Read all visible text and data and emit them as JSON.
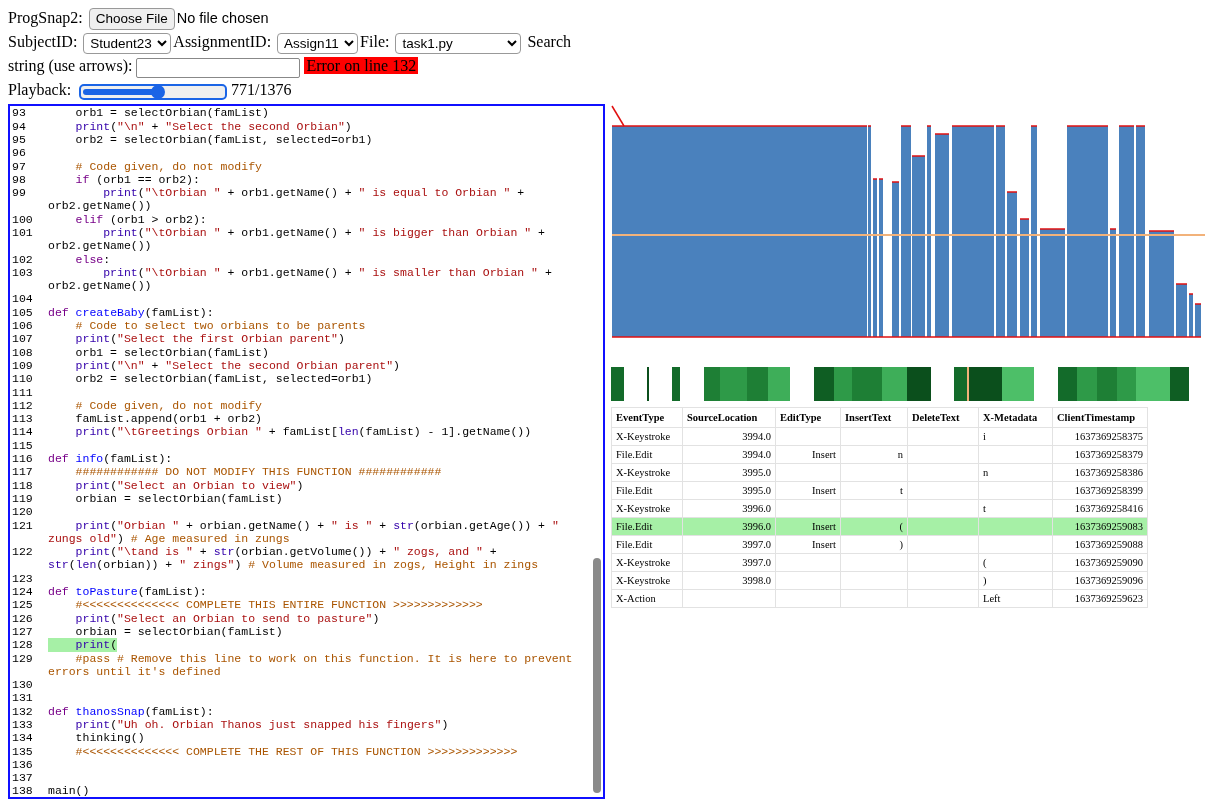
{
  "header": {
    "file_label": "ProgSnap2:",
    "file_button": "Choose File",
    "file_status": "No file chosen",
    "subject_label": "SubjectID:",
    "subject": "Student23",
    "assignment_label": "AssignmentID:",
    "assignment": "Assign11",
    "file_select_label": "File:",
    "file": "task1.py",
    "search_label_lines": [
      "Search",
      "string (use arrows):"
    ],
    "error": "Error on line 132",
    "playback_label": "Playback:",
    "playback": {
      "level": 0.56,
      "reading": "771/1376"
    }
  },
  "editor": {
    "lines": [
      {
        "number": "93",
        "highlighted": false,
        "segments": [
          {
            "text": "    orb1 = selectOrbian(famList)",
            "kind": "plain"
          }
        ]
      },
      {
        "number": "94",
        "highlighted": false,
        "segments": [
          {
            "text": "    print",
            "kind": "builtin"
          },
          {
            "text": "(",
            "kind": "plain"
          },
          {
            "text": "\"\\n\"",
            "kind": "string"
          },
          {
            "text": " + ",
            "kind": "plain"
          },
          {
            "text": "\"Select the second Orbian\"",
            "kind": "string"
          },
          {
            "text": ")",
            "kind": "plain"
          }
        ]
      },
      {
        "number": "95",
        "highlighted": false,
        "segments": [
          {
            "text": "    orb2 = selectOrbian(famList, selected=orb1)",
            "kind": "plain"
          }
        ]
      },
      {
        "number": "96"
      },
      {
        "number": "97",
        "highlighted": false,
        "segments": [
          {
            "text": "    # Code given, do not modify",
            "kind": "comment"
          }
        ]
      },
      {
        "number": "98",
        "highlighted": false,
        "segments": [
          {
            "text": "    if",
            "kind": "keyword"
          },
          {
            "text": " (orb1 == orb2):",
            "kind": "plain"
          }
        ]
      },
      {
        "number": "99",
        "highlighted": false,
        "segments": [
          {
            "text": "        print",
            "kind": "builtin"
          },
          {
            "text": "(",
            "kind": "plain"
          },
          {
            "text": "\"\\tOrbian \"",
            "kind": "string"
          },
          {
            "text": " + orb1.getName() + ",
            "kind": "plain"
          },
          {
            "text": "\" is equal to Orbian \"",
            "kind": "string"
          },
          {
            "text": " + orb2.getName())",
            "kind": "plain"
          }
        ]
      },
      {
        "number": "100",
        "highlighted": false,
        "segments": [
          {
            "text": "    elif",
            "kind": "keyword"
          },
          {
            "text": " (orb1 > orb2):",
            "kind": "plain"
          }
        ]
      },
      {
        "number": "101",
        "highlighted": false,
        "segments": [
          {
            "text": "        print",
            "kind": "builtin"
          },
          {
            "text": "(",
            "kind": "plain"
          },
          {
            "text": "\"\\tOrbian \"",
            "kind": "string"
          },
          {
            "text": " + orb1.getName() + ",
            "kind": "plain"
          },
          {
            "text": "\" is bigger than Orbian \"",
            "kind": "string"
          },
          {
            "text": " + orb2.getName())",
            "kind": "plain"
          }
        ]
      },
      {
        "number": "102",
        "highlighted": false,
        "segments": [
          {
            "text": "    else",
            "kind": "keyword"
          },
          {
            "text": ":",
            "kind": "plain"
          }
        ]
      },
      {
        "number": "103",
        "highlighted": false,
        "segments": [
          {
            "text": "        print",
            "kind": "builtin"
          },
          {
            "text": "(",
            "kind": "plain"
          },
          {
            "text": "\"\\tOrbian \"",
            "kind": "string"
          },
          {
            "text": " + orb1.getName() + ",
            "kind": "plain"
          },
          {
            "text": "\" is smaller than Orbian \"",
            "kind": "string"
          },
          {
            "text": " + orb2.getName())",
            "kind": "plain"
          }
        ]
      },
      {
        "number": "104"
      },
      {
        "number": "105",
        "highlighted": false,
        "segments": [
          {
            "text": "def",
            "kind": "keyword"
          },
          {
            "text": " createBaby",
            "kind": "name"
          },
          {
            "text": "(famList):",
            "kind": "plain"
          }
        ]
      },
      {
        "number": "106",
        "highlighted": false,
        "segments": [
          {
            "text": "    # Code to select two orbians to be parents",
            "kind": "comment"
          }
        ]
      },
      {
        "number": "107",
        "highlighted": false,
        "segments": [
          {
            "text": "    print",
            "kind": "builtin"
          },
          {
            "text": "(",
            "kind": "plain"
          },
          {
            "text": "\"Select the first Orbian parent\"",
            "kind": "string"
          },
          {
            "text": ")",
            "kind": "plain"
          }
        ]
      },
      {
        "number": "108",
        "highlighted": false,
        "segments": [
          {
            "text": "    orb1 = selectOrbian(famList)",
            "kind": "plain"
          }
        ]
      },
      {
        "number": "109",
        "highlighted": false,
        "segments": [
          {
            "text": "    print",
            "kind": "builtin"
          },
          {
            "text": "(",
            "kind": "plain"
          },
          {
            "text": "\"\\n\"",
            "kind": "string"
          },
          {
            "text": " + ",
            "kind": "plain"
          },
          {
            "text": "\"Select the second Orbian parent\"",
            "kind": "string"
          },
          {
            "text": ")",
            "kind": "plain"
          }
        ]
      },
      {
        "number": "110",
        "highlighted": false,
        "segments": [
          {
            "text": "    orb2 = selectOrbian(famList, selected=orb1)",
            "kind": "plain"
          }
        ]
      },
      {
        "number": "111"
      },
      {
        "number": "112",
        "highlighted": false,
        "segments": [
          {
            "text": "    # Code given, do not modify",
            "kind": "comment"
          }
        ]
      },
      {
        "number": "113",
        "highlighted": false,
        "segments": [
          {
            "text": "    famList.append(orb1 + orb2)",
            "kind": "plain"
          }
        ]
      },
      {
        "number": "114",
        "highlighted": false,
        "segments": [
          {
            "text": "    print",
            "kind": "builtin"
          },
          {
            "text": "(",
            "kind": "plain"
          },
          {
            "text": "\"\\tGreetings Orbian \"",
            "kind": "string"
          },
          {
            "text": " + famList[",
            "kind": "plain"
          },
          {
            "text": "len",
            "kind": "builtin"
          },
          {
            "text": "(famList) - 1].getName())",
            "kind": "plain"
          }
        ]
      },
      {
        "number": "115"
      },
      {
        "number": "116",
        "highlighted": false,
        "segments": [
          {
            "text": "def",
            "kind": "keyword"
          },
          {
            "text": " info",
            "kind": "name"
          },
          {
            "text": "(famList):",
            "kind": "plain"
          }
        ]
      },
      {
        "number": "117",
        "highlighted": false,
        "segments": [
          {
            "text": "    ############ DO NOT MODIFY THIS FUNCTION ############",
            "kind": "comment"
          }
        ]
      },
      {
        "number": "118",
        "highlighted": false,
        "segments": [
          {
            "text": "    print",
            "kind": "builtin"
          },
          {
            "text": "(",
            "kind": "plain"
          },
          {
            "text": "\"Select an Orbian to view\"",
            "kind": "string"
          },
          {
            "text": ")",
            "kind": "plain"
          }
        ]
      },
      {
        "number": "119",
        "highlighted": false,
        "segments": [
          {
            "text": "    orbian = selectOrbian(famList)",
            "kind": "plain"
          }
        ]
      },
      {
        "number": "120"
      },
      {
        "number": "121",
        "highlighted": false,
        "segments": [
          {
            "text": "    print",
            "kind": "builtin"
          },
          {
            "text": "(",
            "kind": "plain"
          },
          {
            "text": "\"Orbian \"",
            "kind": "string"
          },
          {
            "text": " + orbian.getName() + ",
            "kind": "plain"
          },
          {
            "text": "\" is \"",
            "kind": "string"
          },
          {
            "text": " + ",
            "kind": "plain"
          },
          {
            "text": "str",
            "kind": "builtin"
          },
          {
            "text": "(orbian.getAge()) + ",
            "kind": "plain"
          },
          {
            "text": "\" zungs old\"",
            "kind": "string"
          },
          {
            "text": ") ",
            "kind": "plain"
          },
          {
            "text": "# Age measured in zungs",
            "kind": "comment"
          }
        ]
      },
      {
        "number": "122",
        "highlighted": false,
        "segments": [
          {
            "text": "    print",
            "kind": "builtin"
          },
          {
            "text": "(",
            "kind": "plain"
          },
          {
            "text": "\"\\tand is \"",
            "kind": "string"
          },
          {
            "text": " + ",
            "kind": "plain"
          },
          {
            "text": "str",
            "kind": "builtin"
          },
          {
            "text": "(orbian.getVolume()) + ",
            "kind": "plain"
          },
          {
            "text": "\" zogs, and \"",
            "kind": "string"
          },
          {
            "text": " + ",
            "kind": "plain"
          },
          {
            "text": "str",
            "kind": "builtin"
          },
          {
            "text": "(",
            "kind": "plain"
          },
          {
            "text": "len",
            "kind": "builtin"
          },
          {
            "text": "(orbian)) + ",
            "kind": "plain"
          },
          {
            "text": "\" zings\"",
            "kind": "string"
          },
          {
            "text": ") ",
            "kind": "plain"
          },
          {
            "text": "# Volume measured in zogs, Height in zings",
            "kind": "comment"
          }
        ]
      },
      {
        "number": "123"
      },
      {
        "number": "124",
        "highlighted": false,
        "segments": [
          {
            "text": "def",
            "kind": "keyword"
          },
          {
            "text": " toPasture",
            "kind": "name"
          },
          {
            "text": "(famList):",
            "kind": "plain"
          }
        ]
      },
      {
        "number": "125",
        "highlighted": false,
        "segments": [
          {
            "text": "    #<<<<<<<<<<<<<< COMPLETE THIS ENTIRE FUNCTION >>>>>>>>>>>>>",
            "kind": "comment"
          }
        ]
      },
      {
        "number": "126",
        "highlighted": false,
        "segments": [
          {
            "text": "    print",
            "kind": "builtin"
          },
          {
            "text": "(",
            "kind": "plain"
          },
          {
            "text": "\"Select an Orbian to send to pasture\"",
            "kind": "string"
          },
          {
            "text": ")",
            "kind": "plain"
          }
        ]
      },
      {
        "number": "127",
        "highlighted": false,
        "segments": [
          {
            "text": "    orbian = selectOrbian(famList)",
            "kind": "plain"
          }
        ]
      },
      {
        "number": "128",
        "highlighted": true,
        "segments": [
          {
            "text": "    print",
            "kind": "builtin"
          },
          {
            "text": "(",
            "kind": "plain"
          }
        ]
      },
      {
        "number": "129",
        "highlighted": false,
        "segments": [
          {
            "text": "    #pass # Remove this line to work on this function. It is here to prevent errors until it's defined",
            "kind": "comment"
          }
        ]
      },
      {
        "number": "130"
      },
      {
        "number": "131"
      },
      {
        "number": "132",
        "highlighted": false,
        "segments": [
          {
            "text": "def",
            "kind": "keyword"
          },
          {
            "text": " thanosSnap",
            "kind": "name"
          },
          {
            "text": "(famList):",
            "kind": "plain"
          }
        ]
      },
      {
        "number": "133",
        "highlighted": false,
        "segments": [
          {
            "text": "    print",
            "kind": "builtin"
          },
          {
            "text": "(",
            "kind": "plain"
          },
          {
            "text": "\"Uh oh. Orbian Thanos just snapped his fingers\"",
            "kind": "string"
          },
          {
            "text": ")",
            "kind": "plain"
          }
        ]
      },
      {
        "number": "134",
        "highlighted": false,
        "segments": [
          {
            "text": "    thinking()",
            "kind": "plain"
          }
        ]
      },
      {
        "number": "135",
        "highlighted": false,
        "segments": [
          {
            "text": "    #<<<<<<<<<<<<<< COMPLETE THE REST OF THIS FUNCTION >>>>>>>>>>>>>",
            "kind": "comment"
          }
        ]
      },
      {
        "number": "136"
      },
      {
        "number": "137"
      },
      {
        "number": "138",
        "highlighted": false,
        "segments": [
          {
            "text": "main()",
            "kind": "plain"
          }
        ]
      }
    ]
  },
  "events": {
    "columns": [
      "EventType",
      "SourceLocation",
      "EditType",
      "InsertText",
      "DeleteText",
      "X-Metadata",
      "ClientTimestamp"
    ],
    "rows": [
      {
        "selected": false,
        "cells": [
          "X-Keystroke",
          "3994.0",
          "",
          "",
          "",
          "i",
          "1637369258375"
        ]
      },
      {
        "selected": false,
        "cells": [
          "File.Edit",
          "3994.0",
          "Insert",
          "n",
          "",
          "",
          "1637369258379"
        ]
      },
      {
        "selected": false,
        "cells": [
          "X-Keystroke",
          "3995.0",
          "",
          "",
          "",
          "n",
          "1637369258386"
        ]
      },
      {
        "selected": false,
        "cells": [
          "File.Edit",
          "3995.0",
          "Insert",
          "t",
          "",
          "",
          "1637369258399"
        ]
      },
      {
        "selected": false,
        "cells": [
          "X-Keystroke",
          "3996.0",
          "",
          "",
          "",
          "t",
          "1637369258416"
        ]
      },
      {
        "selected": true,
        "cells": [
          "File.Edit",
          "3996.0",
          "Insert",
          "(",
          "",
          "",
          "1637369259083"
        ]
      },
      {
        "selected": false,
        "cells": [
          "File.Edit",
          "3997.0",
          "Insert",
          ")",
          "",
          "",
          "1637369259088"
        ]
      },
      {
        "selected": false,
        "cells": [
          "X-Keystroke",
          "3997.0",
          "",
          "",
          "",
          "(",
          "1637369259090"
        ]
      },
      {
        "selected": false,
        "cells": [
          "X-Keystroke",
          "3998.0",
          "",
          "",
          "",
          ")",
          "1637369259096"
        ]
      },
      {
        "selected": false,
        "cells": [
          "X-Action",
          "",
          "",
          "",
          "",
          "Left",
          "1637369259623"
        ]
      }
    ]
  }
}
